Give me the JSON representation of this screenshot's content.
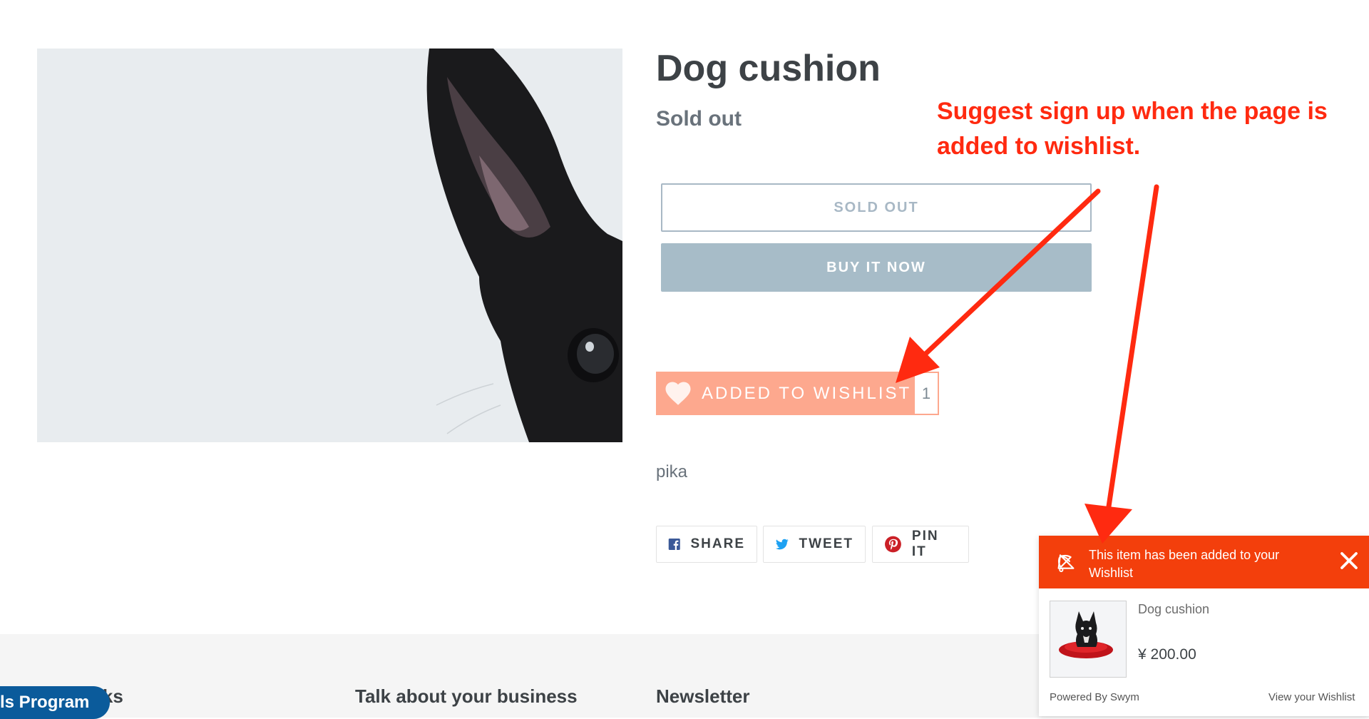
{
  "product": {
    "title": "Dog cushion",
    "status": "Sold out",
    "sold_out_label": "SOLD OUT",
    "buy_now_label": "BUY IT NOW",
    "wishlist_label": "ADDED TO WISHLIST",
    "wishlist_count": "1",
    "description": "pika"
  },
  "share": {
    "facebook": "SHARE",
    "twitter": "TWEET",
    "pinterest": "PIN IT"
  },
  "footer": {
    "links_heading": "nks",
    "business_heading": "Talk about your business",
    "newsletter_heading": "Newsletter",
    "rewards_badge": "ls Program"
  },
  "swym_popup": {
    "message": "This item has been added to your Wishlist",
    "product_title": "Dog cushion",
    "product_price": "¥ 200.00",
    "powered_by": "Powered By Swym",
    "view_wishlist": "View your Wishlist"
  },
  "annotation": {
    "text": "Suggest sign up when the page is added to wishlist."
  },
  "colors": {
    "wishlist": "#fda88e",
    "swym_header": "#f33f0c",
    "annotation": "#ff2a10",
    "buy_now": "#a7bcc8"
  }
}
